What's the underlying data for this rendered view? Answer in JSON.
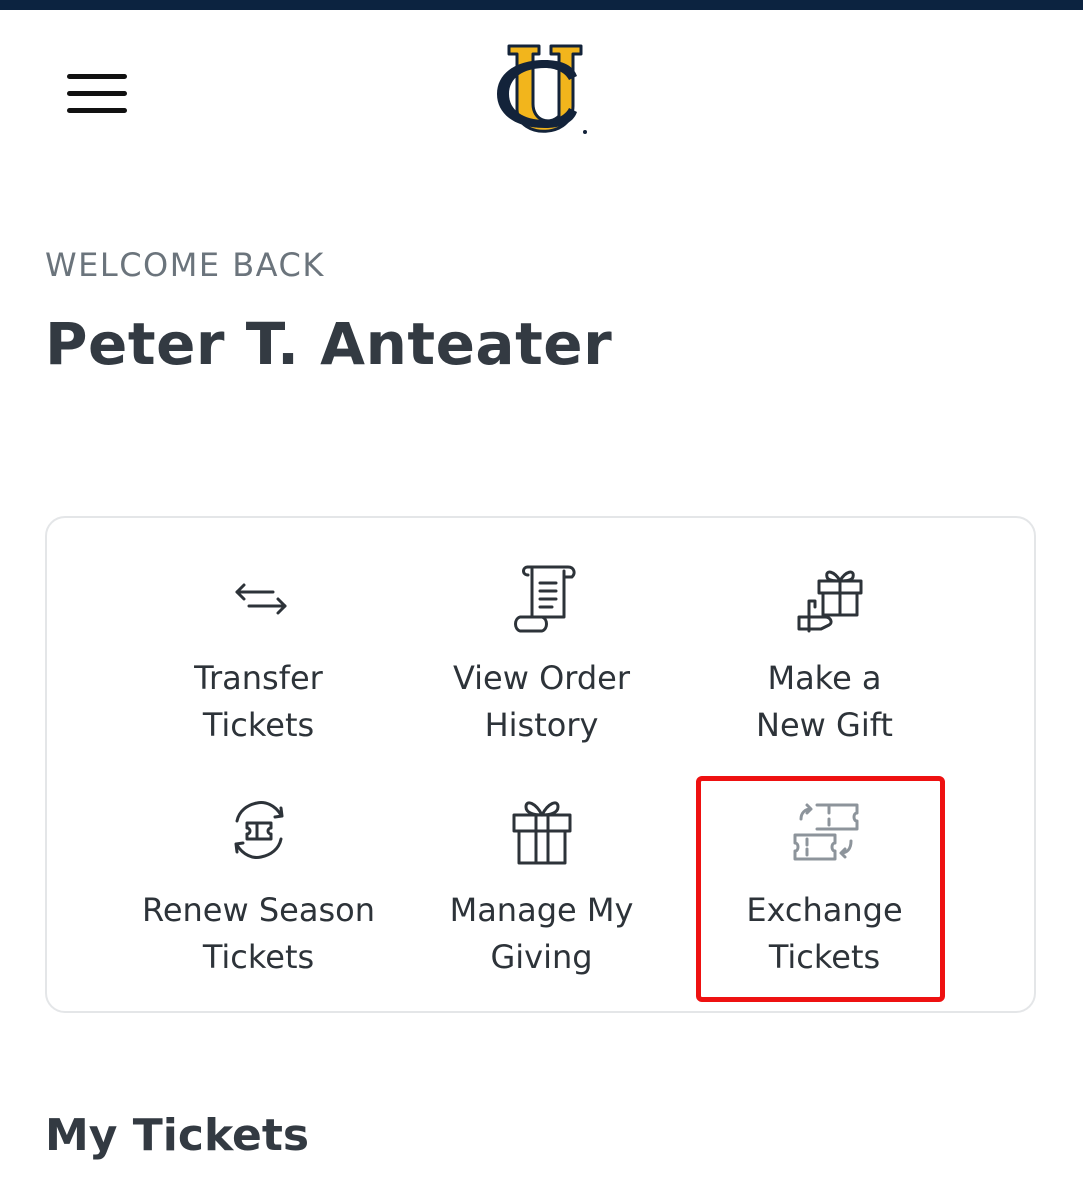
{
  "header": {
    "logo_label": "UC",
    "colors": {
      "topbar": "#0c2340",
      "logo_gold": "#f2b51c",
      "logo_navy": "#13233a"
    }
  },
  "welcome": {
    "kicker": "WELCOME BACK",
    "name": "Peter T. Anteater"
  },
  "actions": [
    {
      "label": "Transfer\nTickets",
      "icon": "transfer-arrows-icon"
    },
    {
      "label": "View Order\nHistory",
      "icon": "scroll-receipt-icon"
    },
    {
      "label": "Make a\nNew Gift",
      "icon": "gift-in-hand-icon"
    },
    {
      "label": "Renew Season\nTickets",
      "icon": "renew-ticket-icon"
    },
    {
      "label": "Manage My\nGiving",
      "icon": "gift-box-icon"
    },
    {
      "label": "Exchange\nTickets",
      "icon": "exchange-tickets-icon",
      "highlighted": true
    }
  ],
  "highlight_color": "#ee1111",
  "my_tickets": {
    "title": "My Tickets"
  }
}
